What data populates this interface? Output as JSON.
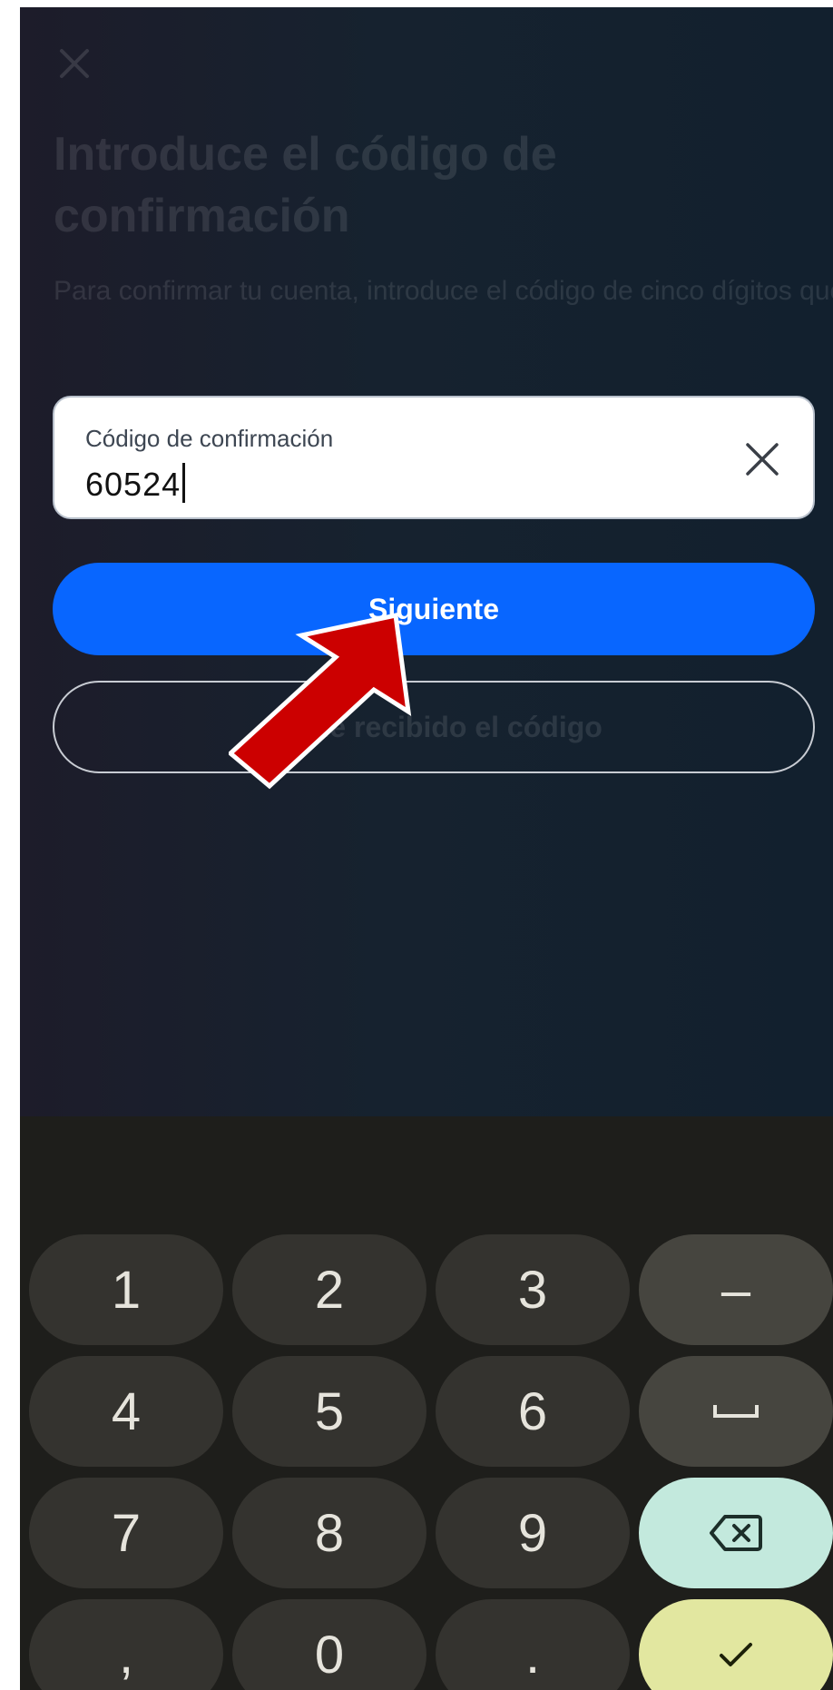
{
  "header": {
    "close_icon": "close-icon"
  },
  "title": "Introduce el código de confirmación",
  "description": "Para confirmar tu cuenta, introduce el código de cinco dígitos que hemos enviado a guicasler@gmail.com.",
  "code_field": {
    "label": "Código de confirmación",
    "value": "60524",
    "clear_icon": "close-icon"
  },
  "buttons": {
    "next": "Siguiente",
    "no_code": "No he recibido el código"
  },
  "annotation": {
    "arrow_color": "#cc0000",
    "pointing_to": "Siguiente"
  },
  "keyboard": {
    "rows": [
      [
        "1",
        "2",
        "3",
        "–"
      ],
      [
        "4",
        "5",
        "6",
        "␣"
      ],
      [
        "7",
        "8",
        "9",
        "⌫"
      ],
      [
        ",",
        "0",
        ".",
        "✓"
      ]
    ],
    "icons": {
      "space": "space-icon",
      "backspace": "backspace-icon",
      "done": "check-icon"
    }
  },
  "colors": {
    "primary": "#0866ff",
    "background": "#16222f",
    "keyboard_bg": "#1e1e1b",
    "delete_key": "#c3e9dd",
    "enter_key": "#e2e7a0"
  }
}
